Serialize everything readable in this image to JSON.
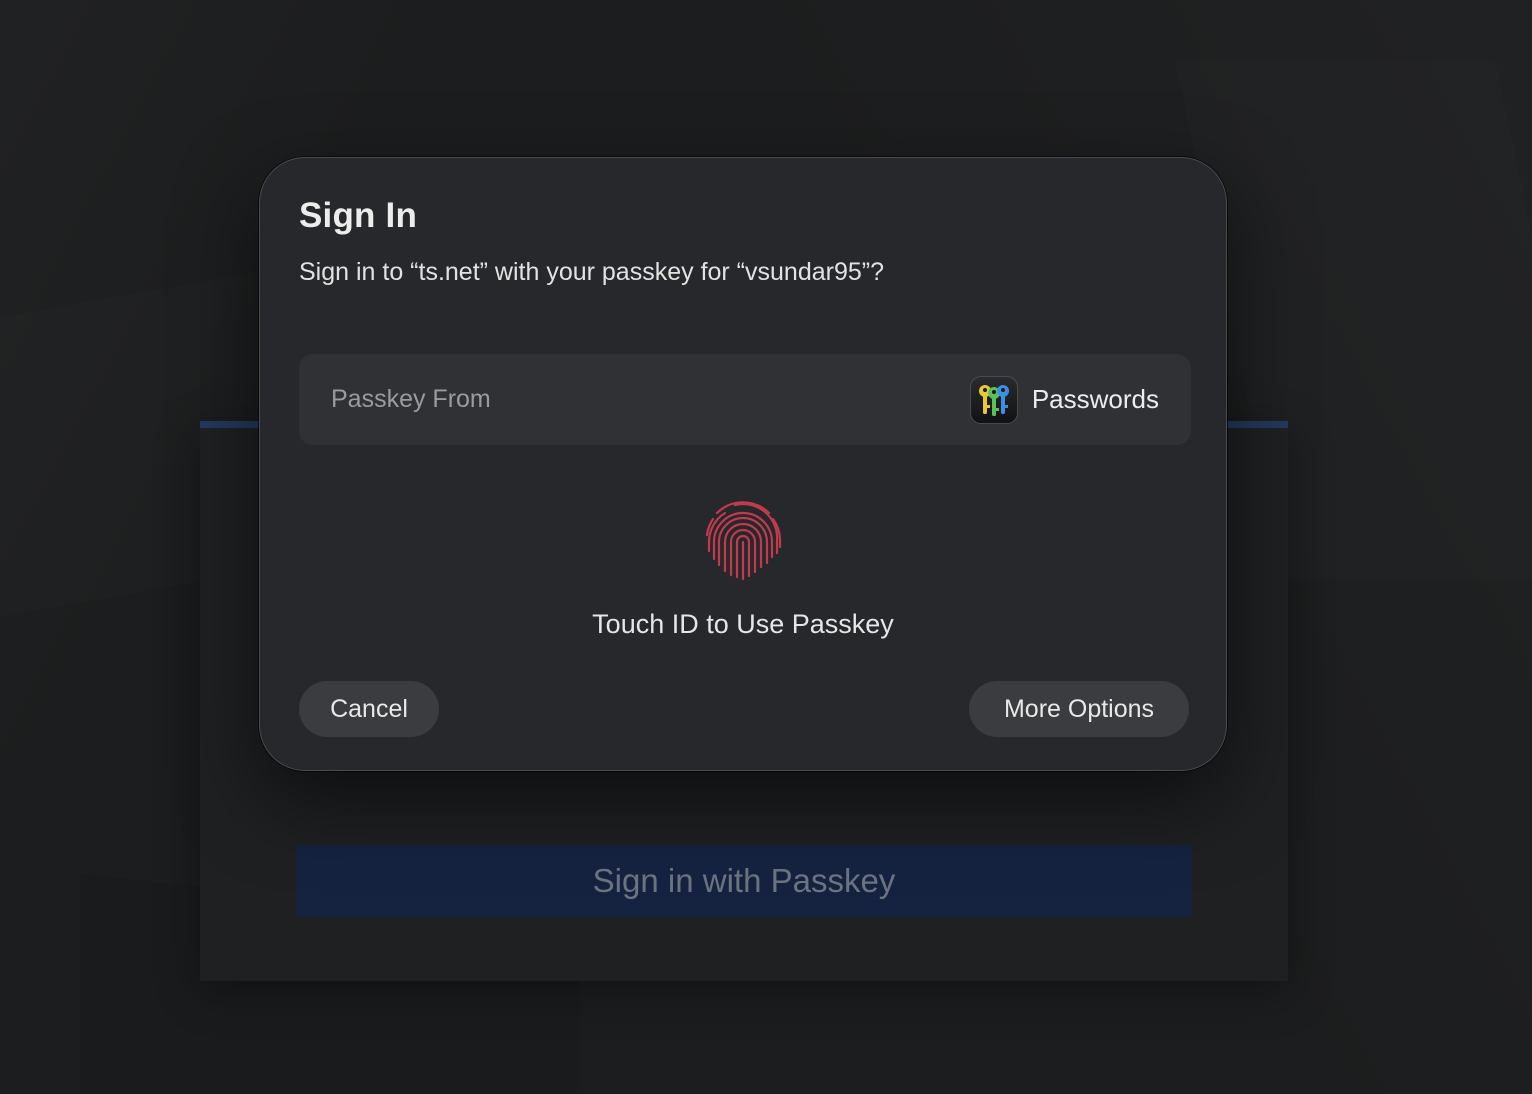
{
  "background_page": {
    "passkey_button_label": "Sign in with Passkey"
  },
  "dialog": {
    "title": "Sign In",
    "message": "Sign in to “ts.net” with your passkey for “vsundar95”?",
    "passkey_source": {
      "label": "Passkey From",
      "app_name": "Passwords",
      "app_icon": "passwords-keys-icon"
    },
    "touch_id": {
      "icon": "fingerprint-icon",
      "label": "Touch ID to Use Passkey"
    },
    "cancel_label": "Cancel",
    "more_options_label": "More Options"
  },
  "colors": {
    "fingerprint": "#c23a4e",
    "page_button_bg": "#152341",
    "accent_bar": "#24385f",
    "key_yellow": "#e8c53a",
    "key_green": "#5cc05a",
    "key_blue": "#3d8fe6"
  }
}
